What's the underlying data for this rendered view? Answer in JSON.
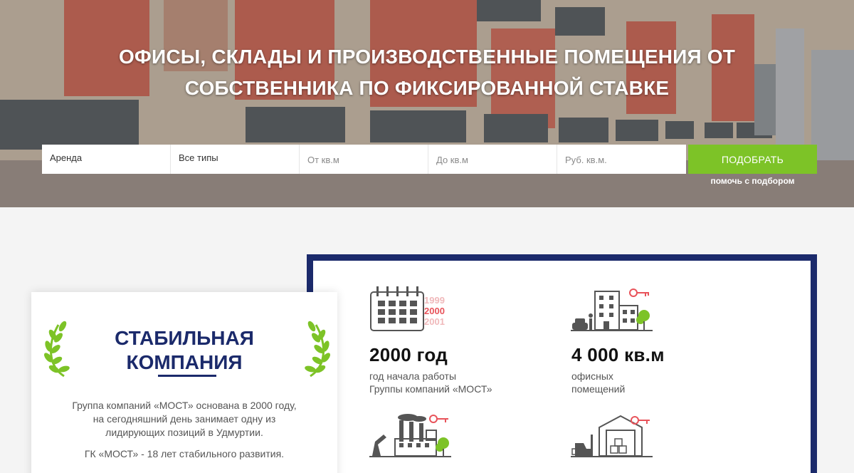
{
  "hero": {
    "title_line1": "ОФИСЫ, СКЛАДЫ И ПРОИЗВОДСТВЕННЫЕ ПОМЕЩЕНИЯ ОТ",
    "title_line2": "СОБСТВЕННИКА ПО ФИКСИРОВАННОЙ СТАВКЕ"
  },
  "search": {
    "deal_type": "Аренда",
    "property_type": "Все типы",
    "area_from_placeholder": "От кв.м",
    "area_to_placeholder": "До кв.м",
    "price_placeholder": "Руб. кв.м.",
    "submit_label": "ПОДОБРАТЬ",
    "help_link": "помочь с подбором"
  },
  "about": {
    "title_line1": "СТАБИЛЬНАЯ",
    "title_line2": "КОМПАНИЯ",
    "text_line1": "Группа компаний «МОСТ» основана в 2000 году,",
    "text_line2": "на сегодняшний день занимает одну из",
    "text_line3": "лидирующих позиций в Удмуртии.",
    "text2": "ГК «МОСТ» - 18 лет стабильного развития."
  },
  "stats": {
    "year_icon_years": [
      "1999",
      "2000",
      "2001"
    ],
    "year_value": "2000 год",
    "year_label_line1": "год начала работы",
    "year_label_line2": "Группы компаний «МОСТ»",
    "office_value": "4 000 кв.м",
    "office_label_line1": "офисных",
    "office_label_line2": "помещений"
  },
  "colors": {
    "brand_navy": "#1b2a6b",
    "accent_green": "#7dc327",
    "accent_red": "#e8535a"
  },
  "icons": [
    "calendar-icon",
    "office-building-icon",
    "factory-icon",
    "warehouse-icon",
    "laurel-icon",
    "key-icon"
  ]
}
